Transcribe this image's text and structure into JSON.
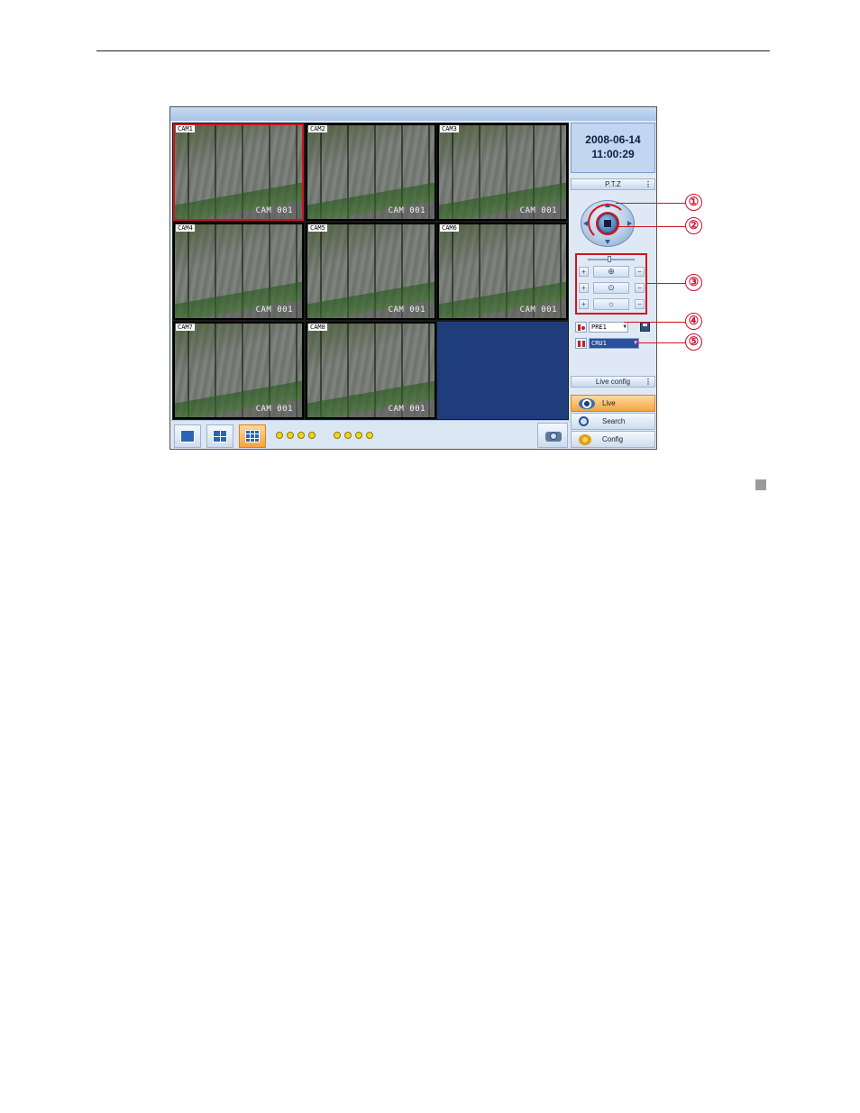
{
  "camera_tiles": [
    {
      "label": "CAM1",
      "caption": "CAM 001",
      "selected": true
    },
    {
      "label": "CAM2",
      "caption": "CAM 001"
    },
    {
      "label": "CAM3",
      "caption": "CAM 001"
    },
    {
      "label": "CAM4",
      "caption": "CAM 001"
    },
    {
      "label": "CAM5",
      "caption": "CAM 001"
    },
    {
      "label": "CAM6",
      "caption": "CAM 001"
    },
    {
      "label": "CAM7",
      "caption": "CAM 001"
    },
    {
      "label": "CAM8",
      "caption": "CAM 001"
    }
  ],
  "clock": {
    "date": "2008-06-14",
    "time": "11:00:29"
  },
  "ptz_panel": {
    "title": "P.T.Z",
    "more": "⋮"
  },
  "ptz_controls": {
    "plus": "+",
    "minus": "−"
  },
  "preset": {
    "value": "PRE1"
  },
  "cruise": {
    "value": "CRU1"
  },
  "live_config": {
    "title": "Live config",
    "more": "⋮"
  },
  "menu": {
    "live": "Live",
    "search": "Search",
    "config": "Config"
  },
  "callouts": [
    "①",
    "②",
    "③",
    "④",
    "⑤"
  ],
  "icons": [
    "pan-tilt-ring-icon",
    "stop-icon",
    "focus-icon",
    "zoom-icon",
    "iris-icon",
    "preset-icon",
    "save-icon",
    "cruise-icon",
    "eye-icon",
    "search-icon",
    "gear-icon",
    "snapshot-icon"
  ],
  "colors": {
    "selected_border": "#d0141c",
    "active_button": "#f5a545",
    "empty_tile": "#1f3d7a",
    "callout": "#c8102e"
  }
}
